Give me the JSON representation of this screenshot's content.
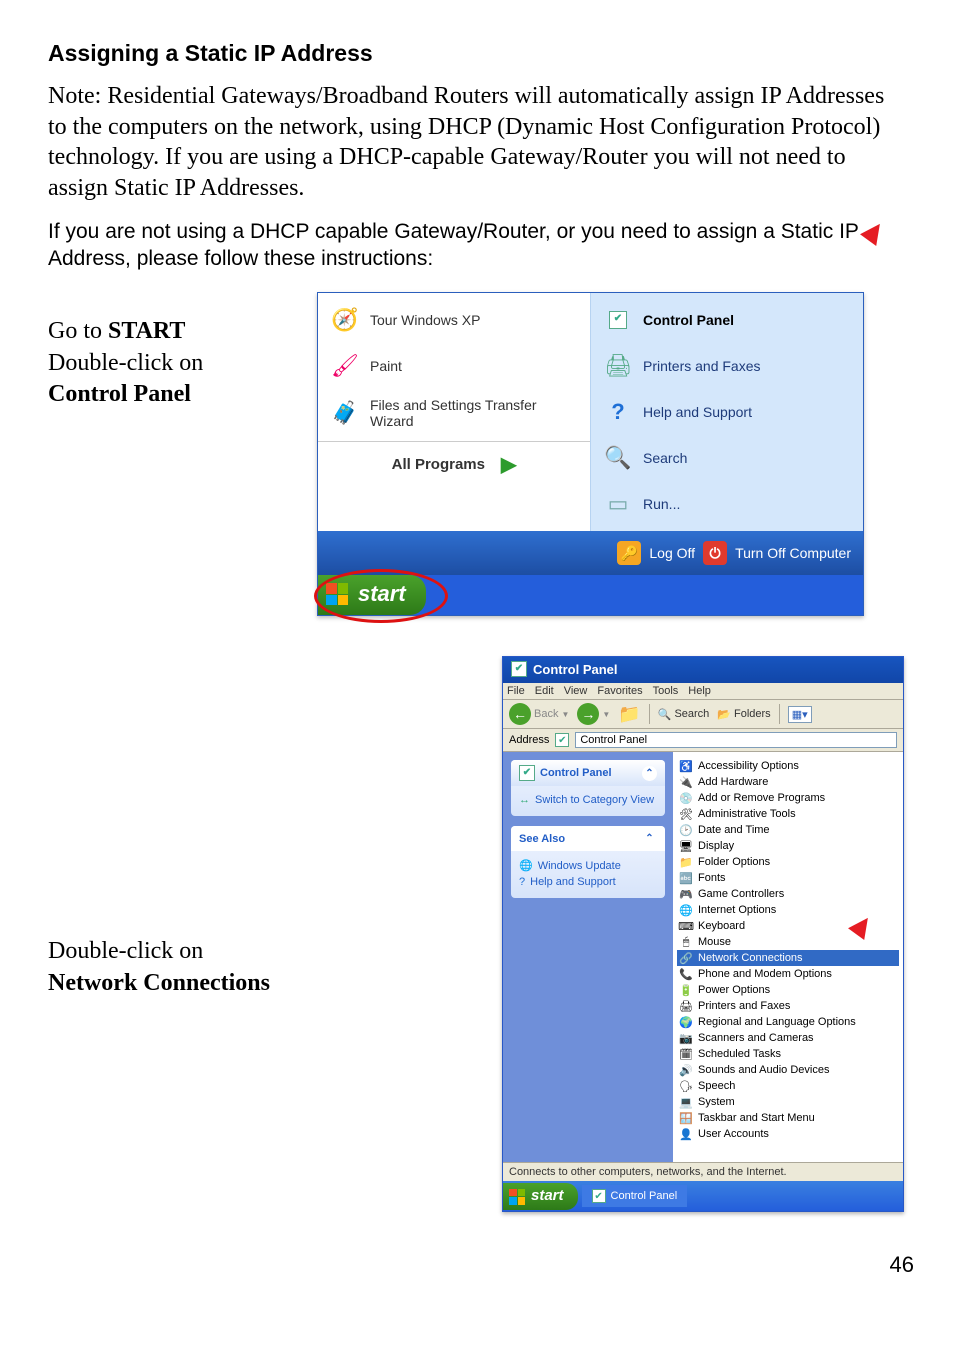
{
  "heading": "Assigning a Static IP Address",
  "note_paragraph": "Note:  Residential Gateways/Broadband Routers will automatically assign IP Addresses to the computers on the network, using DHCP (Dynamic Host Configuration Protocol) technology.  If you are using a DHCP-capable Gateway/Router you will not need to assign Static IP Addresses.",
  "instructions_paragraph": "If you are not using a DHCP capable Gateway/Router, or you need to assign a Static IP Address, please follow these instructions:",
  "step1": {
    "line1_pre": "Go to ",
    "line1_bold": "START",
    "line2": "Double-click on",
    "line3_bold": "Control Panel"
  },
  "step2": {
    "line1": "Double-click on",
    "line2_bold": "Network Connections"
  },
  "start_menu": {
    "left_items": [
      {
        "label": "Tour Windows XP",
        "icon": "🧭"
      },
      {
        "label": "Paint",
        "icon": "🖌"
      },
      {
        "label": "Files and Settings Transfer Wizard",
        "icon": "🧳"
      }
    ],
    "right_items": [
      {
        "label": "Control Panel",
        "icon": "⚙",
        "bold": true
      },
      {
        "label": "Printers and Faxes",
        "icon": "🖨"
      },
      {
        "label": "Help and Support",
        "icon": "❓"
      },
      {
        "label": "Search",
        "icon": "🔍"
      },
      {
        "label": "Run...",
        "icon": "▭"
      }
    ],
    "all_programs": "All Programs",
    "log_off": "Log Off",
    "turn_off": "Turn Off Computer",
    "start": "start"
  },
  "control_panel": {
    "title": "Control Panel",
    "menus": [
      "File",
      "Edit",
      "View",
      "Favorites",
      "Tools",
      "Help"
    ],
    "toolbar": {
      "back": "Back",
      "search": "Search",
      "folders": "Folders"
    },
    "address_label": "Address",
    "address_value": "Control Panel",
    "side": {
      "panel1_title": "Control Panel",
      "panel1_link": "Switch to Category View",
      "panel2_title": "See Also",
      "panel2_links": [
        "Windows Update",
        "Help and Support"
      ]
    },
    "items": [
      "Accessibility Options",
      "Add Hardware",
      "Add or Remove Programs",
      "Administrative Tools",
      "Date and Time",
      "Display",
      "Folder Options",
      "Fonts",
      "Game Controllers",
      "Internet Options",
      "Keyboard",
      "Mouse",
      "Network Connections",
      "Phone and Modem Options",
      "Power Options",
      "Printers and Faxes",
      "Regional and Language Options",
      "Scanners and Cameras",
      "Scheduled Tasks",
      "Sounds and Audio Devices",
      "Speech",
      "System",
      "Taskbar and Start Menu",
      "User Accounts"
    ],
    "selected_item": "Network Connections",
    "status": "Connects to other computers, networks, and the Internet.",
    "taskbar_start": "start",
    "taskbar_btn": "Control Panel"
  },
  "page_number": "46"
}
